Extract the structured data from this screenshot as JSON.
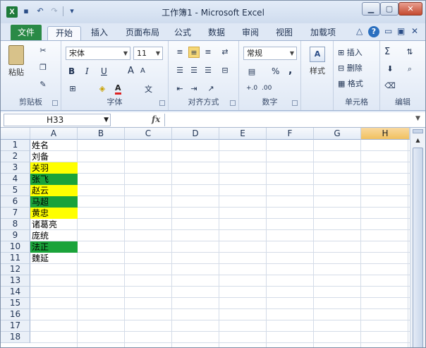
{
  "window": {
    "title": "工作簿1 - Microsoft Excel",
    "app_icon": "X"
  },
  "tabs": {
    "file": "文件",
    "items": [
      "开始",
      "插入",
      "页面布局",
      "公式",
      "数据",
      "审阅",
      "视图",
      "加载项"
    ]
  },
  "ribbon": {
    "clipboard": {
      "label": "剪贴板",
      "paste": "粘贴"
    },
    "font": {
      "label": "字体",
      "family": "宋体",
      "size": "11",
      "bold": "B",
      "italic": "I",
      "underline": "U",
      "grow": "A",
      "shrink": "A"
    },
    "alignment": {
      "label": "对齐方式"
    },
    "number": {
      "label": "数字",
      "format": "常规",
      "percent": "%",
      "comma": ","
    },
    "styles": {
      "label": "样式"
    },
    "cells": {
      "label": "单元格",
      "insert": "插入",
      "delete": "删除",
      "format": "格式"
    },
    "editing": {
      "label": "编辑",
      "sum": "Σ"
    }
  },
  "formula_bar": {
    "name_box": "H33",
    "fx": "fx",
    "value": ""
  },
  "columns": [
    "A",
    "B",
    "C",
    "D",
    "E",
    "F",
    "G",
    "H"
  ],
  "selected_column": "H",
  "rows": [
    "1",
    "2",
    "3",
    "4",
    "5",
    "6",
    "7",
    "8",
    "9",
    "10",
    "11",
    "12",
    "13",
    "14",
    "15",
    "16",
    "17",
    "18"
  ],
  "cells": {
    "A1": "姓名",
    "A2": "刘备",
    "A3": "关羽",
    "A4": "张飞",
    "A5": "赵云",
    "A6": "马超",
    "A7": "黄忠",
    "A8": "诸葛亮",
    "A9": "庞统",
    "A10": "法正",
    "A11": "魏延"
  },
  "colors": {
    "yellow": "#ffff00",
    "green": "#1aa33a",
    "selected_header": "#f1c15f",
    "file_tab": "#2a8a46"
  }
}
